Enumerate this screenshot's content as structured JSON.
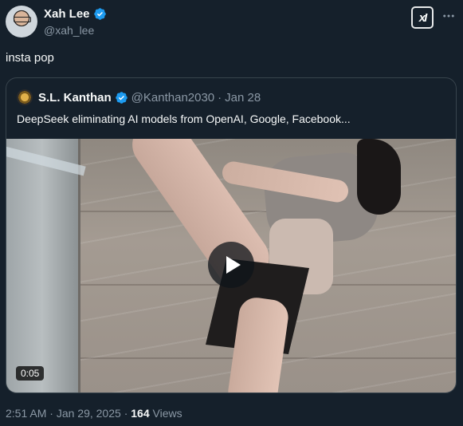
{
  "author": {
    "display_name": "Xah Lee",
    "handle": "@xah_lee"
  },
  "tweet": {
    "text": "insta pop"
  },
  "quote": {
    "display_name": "S.L. Kanthan",
    "handle": "@Kanthan2030",
    "separator": "·",
    "date": "Jan 28",
    "text": "DeepSeek eliminating AI models from OpenAI, Google, Facebook...",
    "video_duration": "0:05"
  },
  "meta": {
    "time": "2:51 AM",
    "separator": "·",
    "date": "Jan 29, 2025",
    "separator2": "·",
    "views_count": "164",
    "views_label": "Views"
  },
  "buttons": {
    "grok_label": "xI"
  },
  "colors": {
    "background": "#15202b",
    "text": "#f7f9f9",
    "muted": "#8b98a5",
    "verified": "#1d9bf0",
    "border": "#38444d"
  },
  "icons": [
    "verified-badge-icon",
    "grok-icon",
    "more-options-icon",
    "play-icon"
  ]
}
